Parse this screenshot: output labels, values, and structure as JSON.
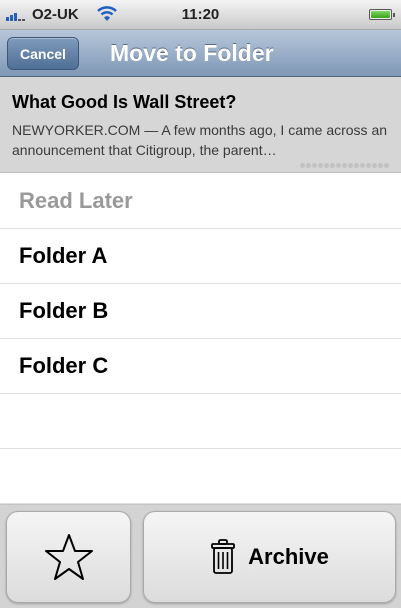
{
  "status_bar": {
    "carrier": "O2-UK",
    "time": "11:20",
    "icons": [
      "signal-icon",
      "wifi-icon",
      "battery-icon"
    ]
  },
  "nav": {
    "cancel_label": "Cancel",
    "title": "Move to Folder"
  },
  "article": {
    "title": "What Good Is Wall Street?",
    "summary": "NEWYORKER.COM — A few months ago, I came across an announcement that Citigroup, the parent…"
  },
  "folders": [
    {
      "label": "Read Later",
      "enabled": false
    },
    {
      "label": "Folder A",
      "enabled": true
    },
    {
      "label": "Folder B",
      "enabled": true
    },
    {
      "label": "Folder C",
      "enabled": true
    }
  ],
  "toolbar": {
    "star_icon": "star-icon",
    "archive_icon": "trash-icon",
    "archive_label": "Archive"
  },
  "colors": {
    "nav_bar": "#8aa2bf",
    "disabled_text": "#999999",
    "battery": "#4cbf2a"
  }
}
